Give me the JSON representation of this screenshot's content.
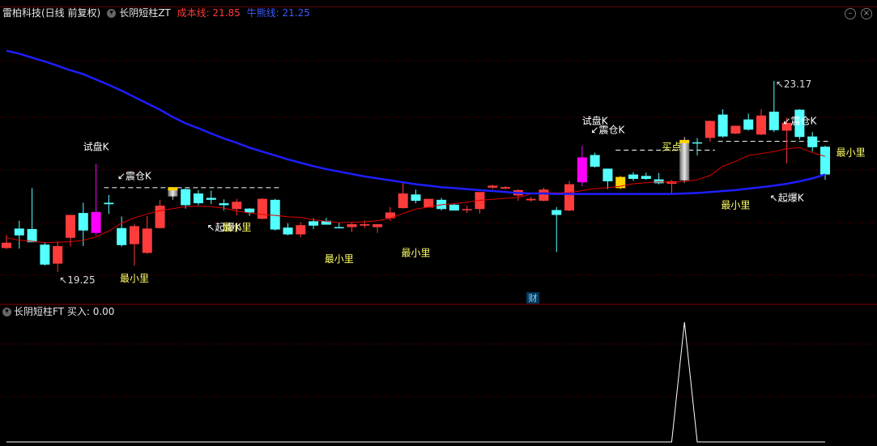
{
  "header": {
    "stock_name": "雷柏科技(日线 前复权)",
    "indicator_name": "长阴短柱ZT",
    "cost_line_label": "成本线: 21.85",
    "bull_line_label": "牛熊线: 21.25"
  },
  "sub_header": {
    "indicator_name": "长阴短柱FT",
    "buy_label": "买入: 0.00"
  },
  "colors": {
    "up": "#ff3c3c",
    "down": "#54ffff",
    "cost_line": "#e00000",
    "bull_line": "#1e1eff",
    "label_yellow": "#ffff66",
    "label_white": "#ffffff",
    "magenta": "#ff00ff",
    "gold": "#ffd400",
    "grid": "#5a0000"
  },
  "finance_marker": "财",
  "chart_data": [
    {
      "type": "candlestick",
      "title": "长阴短柱ZT",
      "y_min": 18.85,
      "y_max": 24.4,
      "high_label": "23.17",
      "low_label": "19.25",
      "candles": [
        {
          "o": 19.85,
          "h": 20.01,
          "l": 19.72,
          "c": 19.74,
          "kind": "up"
        },
        {
          "o": 20.0,
          "h": 20.3,
          "l": 19.73,
          "c": 20.14,
          "kind": "down"
        },
        {
          "o": 20.13,
          "h": 20.97,
          "l": 19.86,
          "c": 19.86,
          "kind": "down"
        },
        {
          "o": 19.81,
          "h": 19.86,
          "l": 19.38,
          "c": 19.4,
          "kind": "down"
        },
        {
          "o": 19.42,
          "h": 19.88,
          "l": 19.25,
          "c": 19.78,
          "kind": "up"
        },
        {
          "o": 19.95,
          "h": 20.42,
          "l": 19.77,
          "c": 20.42,
          "kind": "up"
        },
        {
          "o": 20.1,
          "h": 20.67,
          "l": 19.78,
          "c": 20.46,
          "kind": "down"
        },
        {
          "o": 20.05,
          "h": 21.47,
          "l": 20.0,
          "c": 20.48,
          "kind": "magenta"
        },
        {
          "o": 20.64,
          "h": 20.83,
          "l": 20.44,
          "c": 20.67,
          "kind": "down"
        },
        {
          "o": 20.15,
          "h": 20.39,
          "l": 19.77,
          "c": 19.8,
          "kind": "down"
        },
        {
          "o": 19.82,
          "h": 20.24,
          "l": 19.38,
          "c": 20.19,
          "kind": "up"
        },
        {
          "o": 20.14,
          "h": 20.4,
          "l": 19.62,
          "c": 19.64,
          "kind": "up"
        },
        {
          "o": 20.61,
          "h": 20.73,
          "l": 20.14,
          "c": 20.15,
          "kind": "up"
        },
        {
          "o": 20.94,
          "h": 20.97,
          "l": 20.73,
          "c": 20.8,
          "kind": "grey"
        },
        {
          "o": 20.95,
          "h": 20.96,
          "l": 20.55,
          "c": 20.62,
          "kind": "down"
        },
        {
          "o": 20.86,
          "h": 20.93,
          "l": 20.62,
          "c": 20.66,
          "kind": "down"
        },
        {
          "o": 20.77,
          "h": 20.92,
          "l": 20.64,
          "c": 20.73,
          "kind": "down"
        },
        {
          "o": 20.66,
          "h": 20.74,
          "l": 20.51,
          "c": 20.62,
          "kind": "down"
        },
        {
          "o": 20.54,
          "h": 20.75,
          "l": 20.41,
          "c": 20.69,
          "kind": "up"
        },
        {
          "o": 20.55,
          "h": 20.56,
          "l": 20.4,
          "c": 20.47,
          "kind": "down"
        },
        {
          "o": 20.34,
          "h": 20.77,
          "l": 20.33,
          "c": 20.75,
          "kind": "up"
        },
        {
          "o": 20.73,
          "h": 20.75,
          "l": 20.1,
          "c": 20.12,
          "kind": "down"
        },
        {
          "o": 20.16,
          "h": 20.25,
          "l": 20.0,
          "c": 20.02,
          "kind": "down"
        },
        {
          "o": 20.02,
          "h": 20.27,
          "l": 19.96,
          "c": 20.21,
          "kind": "up"
        },
        {
          "o": 20.2,
          "h": 20.35,
          "l": 20.13,
          "c": 20.29,
          "kind": "down"
        },
        {
          "o": 20.3,
          "h": 20.36,
          "l": 20.25,
          "c": 20.22,
          "kind": "down"
        },
        {
          "o": 20.17,
          "h": 20.26,
          "l": 20.17,
          "c": 20.17,
          "kind": "down"
        },
        {
          "o": 20.17,
          "h": 20.26,
          "l": 20.07,
          "c": 20.23,
          "kind": "up"
        },
        {
          "o": 20.2,
          "h": 20.31,
          "l": 20.15,
          "c": 20.23,
          "kind": "up"
        },
        {
          "o": 20.17,
          "h": 20.23,
          "l": 20.05,
          "c": 20.23,
          "kind": "up"
        },
        {
          "o": 20.35,
          "h": 20.58,
          "l": 20.3,
          "c": 20.47,
          "kind": "up"
        },
        {
          "o": 20.56,
          "h": 21.09,
          "l": 20.55,
          "c": 20.86,
          "kind": "up"
        },
        {
          "o": 20.84,
          "h": 20.94,
          "l": 20.66,
          "c": 20.71,
          "kind": "down"
        },
        {
          "o": 20.57,
          "h": 20.69,
          "l": 20.57,
          "c": 20.75,
          "kind": "up"
        },
        {
          "o": 20.73,
          "h": 20.77,
          "l": 20.51,
          "c": 20.54,
          "kind": "down"
        },
        {
          "o": 20.51,
          "h": 20.65,
          "l": 20.51,
          "c": 20.63,
          "kind": "down"
        },
        {
          "o": 20.52,
          "h": 20.61,
          "l": 20.46,
          "c": 20.54,
          "kind": "up"
        },
        {
          "o": 20.54,
          "h": 20.6,
          "l": 20.45,
          "c": 20.89,
          "kind": "up"
        },
        {
          "o": 20.98,
          "h": 21.04,
          "l": 20.95,
          "c": 21.02,
          "kind": "up"
        },
        {
          "o": 20.96,
          "h": 21.01,
          "l": 20.95,
          "c": 20.99,
          "kind": "up"
        },
        {
          "o": 20.82,
          "h": 20.95,
          "l": 20.71,
          "c": 20.93,
          "kind": "up"
        },
        {
          "o": 20.75,
          "h": 20.79,
          "l": 20.69,
          "c": 20.72,
          "kind": "up"
        },
        {
          "o": 20.71,
          "h": 20.98,
          "l": 20.7,
          "c": 20.94,
          "kind": "up"
        },
        {
          "o": 20.52,
          "h": 20.58,
          "l": 19.66,
          "c": 20.42,
          "kind": "down"
        },
        {
          "o": 20.51,
          "h": 21.12,
          "l": 20.5,
          "c": 21.05,
          "kind": "up"
        },
        {
          "o": 21.09,
          "h": 21.84,
          "l": 21.01,
          "c": 21.6,
          "kind": "magenta"
        },
        {
          "o": 21.65,
          "h": 21.7,
          "l": 21.39,
          "c": 21.41,
          "kind": "down"
        },
        {
          "o": 21.37,
          "h": 21.37,
          "l": 20.95,
          "c": 21.11,
          "kind": "down"
        },
        {
          "o": 20.97,
          "h": 21.22,
          "l": 20.95,
          "c": 21.2,
          "kind": "gold"
        },
        {
          "o": 21.25,
          "h": 21.3,
          "l": 21.12,
          "c": 21.16,
          "kind": "down"
        },
        {
          "o": 21.22,
          "h": 21.29,
          "l": 21.14,
          "c": 21.16,
          "kind": "down"
        },
        {
          "o": 21.15,
          "h": 21.28,
          "l": 21.05,
          "c": 21.07,
          "kind": "down"
        },
        {
          "o": 21.06,
          "h": 21.14,
          "l": 20.86,
          "c": 21.11,
          "kind": "up"
        },
        {
          "o": 21.13,
          "h": 22.02,
          "l": 21.08,
          "c": 21.91,
          "kind": "grey"
        },
        {
          "o": 21.89,
          "h": 22.0,
          "l": 21.64,
          "c": 21.91,
          "kind": "down"
        },
        {
          "o": 22.0,
          "h": 22.36,
          "l": 21.92,
          "c": 22.35,
          "kind": "up"
        },
        {
          "o": 22.48,
          "h": 22.59,
          "l": 22.01,
          "c": 22.03,
          "kind": "down"
        },
        {
          "o": 22.09,
          "h": 22.23,
          "l": 22.08,
          "c": 22.25,
          "kind": "up"
        },
        {
          "o": 22.38,
          "h": 22.5,
          "l": 22.15,
          "c": 22.17,
          "kind": "down"
        },
        {
          "o": 22.07,
          "h": 22.59,
          "l": 22.06,
          "c": 22.46,
          "kind": "up"
        },
        {
          "o": 22.54,
          "h": 23.17,
          "l": 22.12,
          "c": 22.16,
          "kind": "down"
        },
        {
          "o": 22.15,
          "h": 22.42,
          "l": 21.48,
          "c": 22.31,
          "kind": "up"
        },
        {
          "o": 22.58,
          "h": 22.59,
          "l": 21.97,
          "c": 22.02,
          "kind": "down"
        },
        {
          "o": 22.03,
          "h": 22.12,
          "l": 21.72,
          "c": 21.81,
          "kind": "down"
        },
        {
          "o": 21.82,
          "h": 21.84,
          "l": 21.14,
          "c": 21.25,
          "kind": "down"
        }
      ],
      "cost_line": [
        19.95,
        19.9,
        19.88,
        19.85,
        19.86,
        19.87,
        19.9,
        19.97,
        20.09,
        20.25,
        20.36,
        20.44,
        20.51,
        20.55,
        20.59,
        20.6,
        20.59,
        20.56,
        20.5,
        20.46,
        20.43,
        20.41,
        20.38,
        20.37,
        20.32,
        20.29,
        20.26,
        20.27,
        20.28,
        20.3,
        20.35,
        20.45,
        20.54,
        20.58,
        20.63,
        20.65,
        20.68,
        20.72,
        20.74,
        20.76,
        20.78,
        20.85,
        20.88,
        20.87,
        20.88,
        20.92,
        20.96,
        20.98,
        21.01,
        21.06,
        21.08,
        21.1,
        21.09,
        21.11,
        21.14,
        21.23,
        21.42,
        21.52,
        21.64,
        21.68,
        21.72,
        21.78,
        21.8,
        21.7,
        21.62
      ],
      "bull_line": [
        23.79,
        23.73,
        23.65,
        23.57,
        23.48,
        23.39,
        23.31,
        23.2,
        23.09,
        22.97,
        22.84,
        22.71,
        22.58,
        22.43,
        22.3,
        22.2,
        22.09,
        21.99,
        21.9,
        21.8,
        21.72,
        21.64,
        21.56,
        21.49,
        21.42,
        21.36,
        21.31,
        21.26,
        21.21,
        21.17,
        21.13,
        21.09,
        21.05,
        21.02,
        20.99,
        20.97,
        20.95,
        20.93,
        20.91,
        20.89,
        20.87,
        20.86,
        20.86,
        20.85,
        20.85,
        20.85,
        20.85,
        20.85,
        20.85,
        20.85,
        20.85,
        20.85,
        20.85,
        20.86,
        20.87,
        20.89,
        20.91,
        20.93,
        20.96,
        20.99,
        21.02,
        21.06,
        21.11,
        21.17,
        21.25
      ],
      "threshold_lines": [
        {
          "from": 8,
          "to": 21,
          "price": 20.98
        },
        {
          "from": 48,
          "to": 55,
          "price": 21.75
        },
        {
          "from": 56,
          "to": 64,
          "price": 21.93
        }
      ],
      "annotations": [
        {
          "text": "试盘K",
          "candle": 7,
          "price": 21.75,
          "color": "white"
        },
        {
          "text": "↙震仓K",
          "candle": 10,
          "price": 21.15,
          "color": "white"
        },
        {
          "text": "↖起爆K",
          "candle": 17,
          "price": 20.1,
          "color": "white"
        },
        {
          "text": "最小里",
          "candle": 10,
          "price": 19.05,
          "color": "yellow"
        },
        {
          "text": "最小里",
          "candle": 18,
          "price": 20.1,
          "color": "yellow"
        },
        {
          "text": "最小里",
          "candle": 26,
          "price": 19.45,
          "color": "yellow"
        },
        {
          "text": "最小里",
          "candle": 32,
          "price": 19.57,
          "color": "yellow"
        },
        {
          "text": "试盘K",
          "candle": 46,
          "price": 22.28,
          "color": "white"
        },
        {
          "text": "↙震仓K",
          "candle": 47,
          "price": 22.1,
          "color": "white"
        },
        {
          "text": "买点",
          "candle": 52,
          "price": 21.75,
          "color": "yellow"
        },
        {
          "text": "最小里",
          "candle": 57,
          "price": 20.55,
          "color": "yellow"
        },
        {
          "text": "↖起爆K",
          "candle": 61,
          "price": 20.7,
          "color": "white"
        },
        {
          "text": "↙震仓K",
          "candle": 62,
          "price": 22.28,
          "color": "white"
        },
        {
          "text": "最小里",
          "candle": 66,
          "price": 21.63,
          "color": "yellow"
        },
        {
          "text": "最小里",
          "candle": 74,
          "price": 20.58,
          "color": "yellow"
        }
      ]
    },
    {
      "type": "line",
      "title": "长阴短柱FT",
      "series": [
        {
          "name": "买入",
          "values": [
            0,
            0,
            0,
            0,
            0,
            0,
            0,
            0,
            0,
            0,
            0,
            0,
            0,
            0,
            0,
            0,
            0,
            0,
            0,
            0,
            0,
            0,
            0,
            0,
            0,
            0,
            0,
            0,
            0,
            0,
            0,
            0,
            0,
            0,
            0,
            0,
            0,
            0,
            0,
            0,
            0,
            0,
            0,
            0,
            0,
            0,
            0,
            0,
            0,
            0,
            0,
            0,
            0,
            1,
            0,
            0,
            0,
            0,
            0,
            0,
            0,
            0,
            0,
            0,
            0
          ]
        }
      ],
      "ylim": [
        0,
        1
      ]
    }
  ]
}
